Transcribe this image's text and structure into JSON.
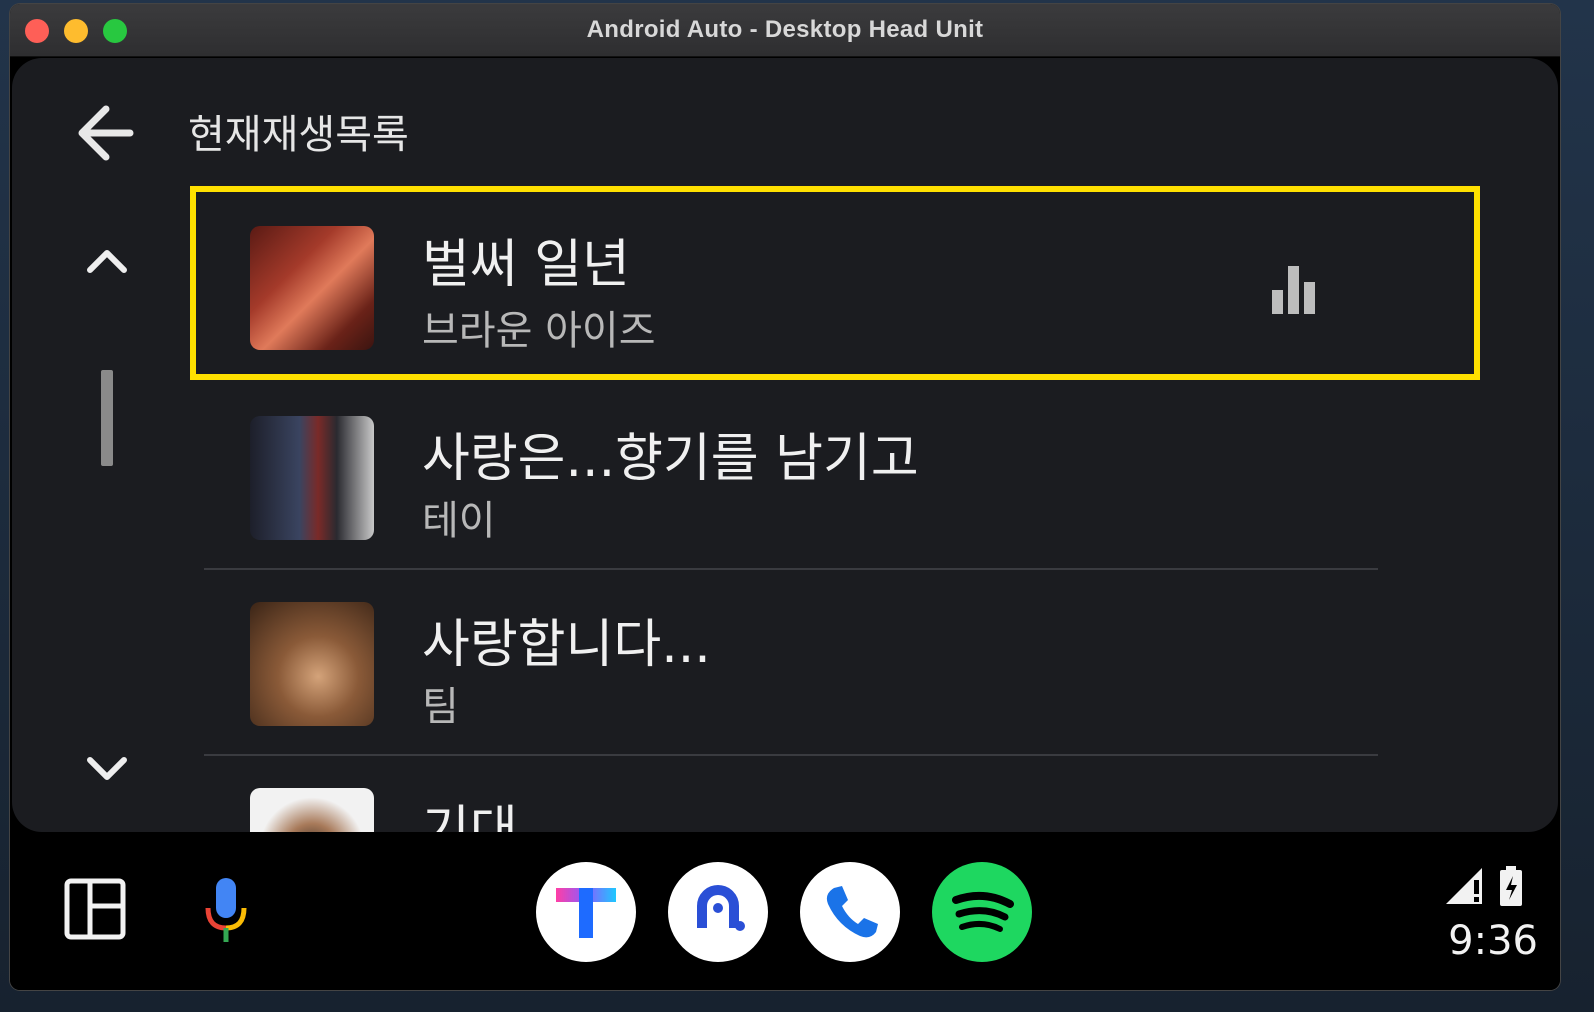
{
  "window": {
    "title": "Android Auto - Desktop Head Unit"
  },
  "header": {
    "title": "현재재생목록"
  },
  "queue": [
    {
      "song": "벌써 일년",
      "artist": "브라운 아이즈",
      "playing": true
    },
    {
      "song": "사랑은...향기를 남기고",
      "artist": "테이",
      "playing": false
    },
    {
      "song": "사랑합니다...",
      "artist": "팀",
      "playing": false
    },
    {
      "song": "기대",
      "artist": "",
      "playing": false
    }
  ],
  "colors": {
    "highlight": "#ffe000",
    "spotify": "#1ed760",
    "tmap_blue": "#1e6bff",
    "tmap_pink": "#ff3ea5"
  },
  "navbar": {
    "apps": [
      "tmap-icon",
      "tmap-auto-icon",
      "phone-icon",
      "spotify-icon"
    ],
    "time": "9:36"
  }
}
